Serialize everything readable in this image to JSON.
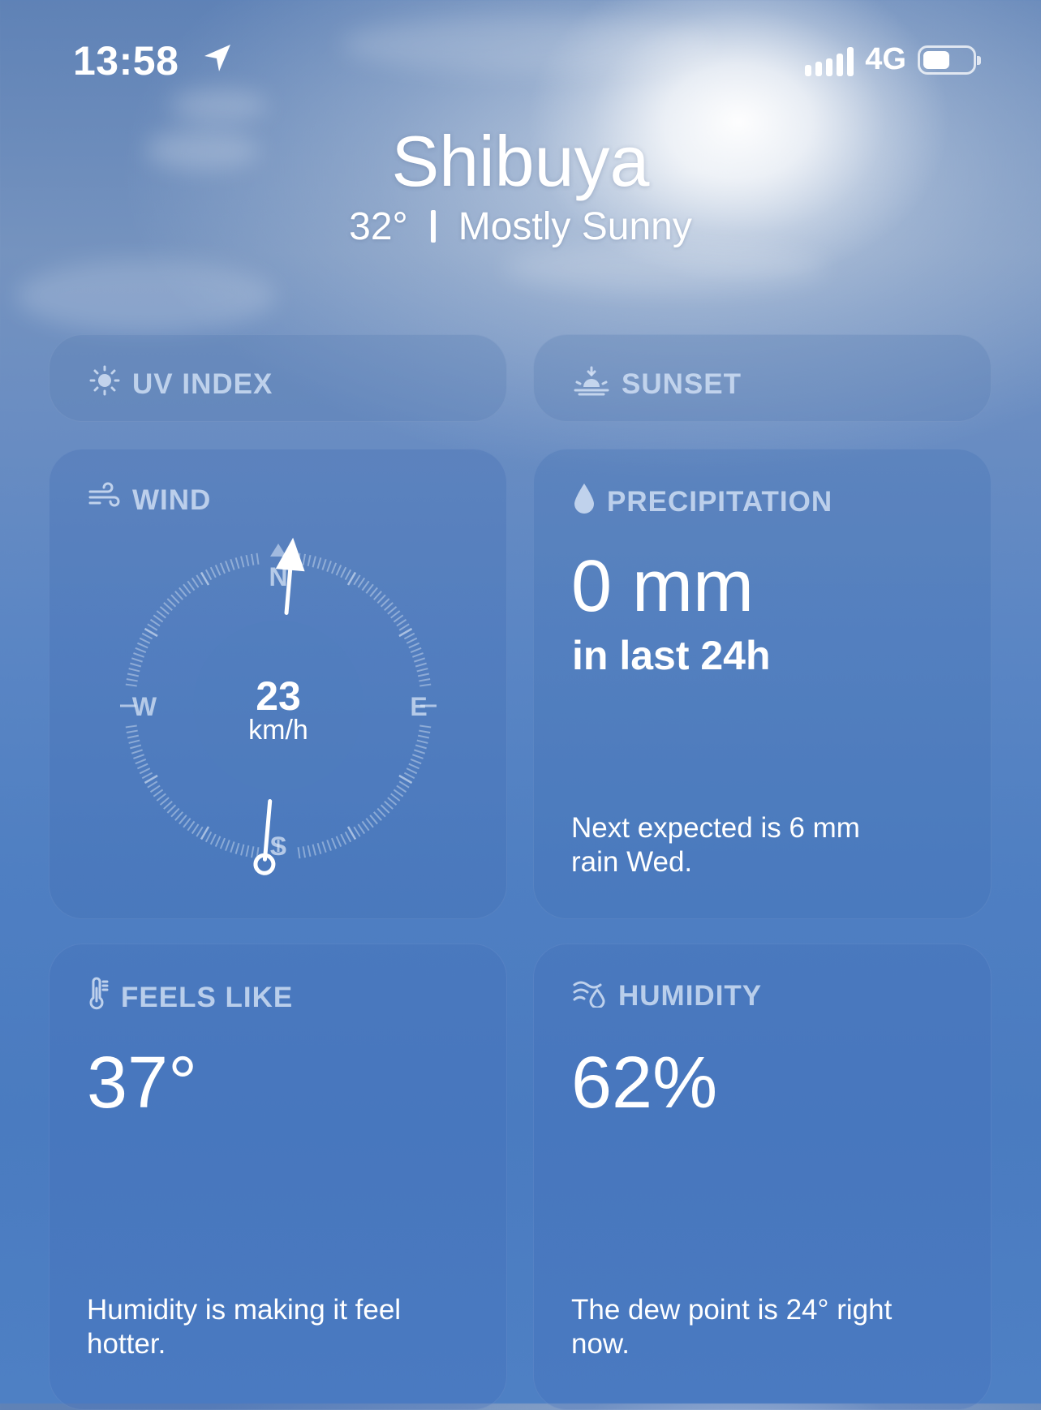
{
  "status_bar": {
    "time": "13:58",
    "network": "4G",
    "battery_level": 0.55
  },
  "header": {
    "city": "Shibuya",
    "temperature": "32°",
    "condition": "Mostly Sunny"
  },
  "cards": {
    "uv": {
      "title": "UV INDEX",
      "icon": "sun-icon"
    },
    "sunset": {
      "title": "SUNSET",
      "icon": "sunset-icon"
    },
    "wind": {
      "title": "WIND",
      "icon": "wind-icon",
      "speed": "23",
      "unit": "km/h",
      "compass": {
        "n": "N",
        "e": "E",
        "s": "S",
        "w": "W"
      },
      "direction_deg": 185
    },
    "precipitation": {
      "title": "PRECIPITATION",
      "icon": "raindrop-icon",
      "value": "0 mm",
      "period": "in last 24h",
      "note": "Next expected is 6 mm rain Wed."
    },
    "feels_like": {
      "title": "FEELS LIKE",
      "icon": "thermometer-icon",
      "value": "37°",
      "note": "Humidity is making it feel hotter."
    },
    "humidity": {
      "title": "HUMIDITY",
      "icon": "humidity-icon",
      "value": "62%",
      "note": "The dew point is 24° right now."
    }
  }
}
